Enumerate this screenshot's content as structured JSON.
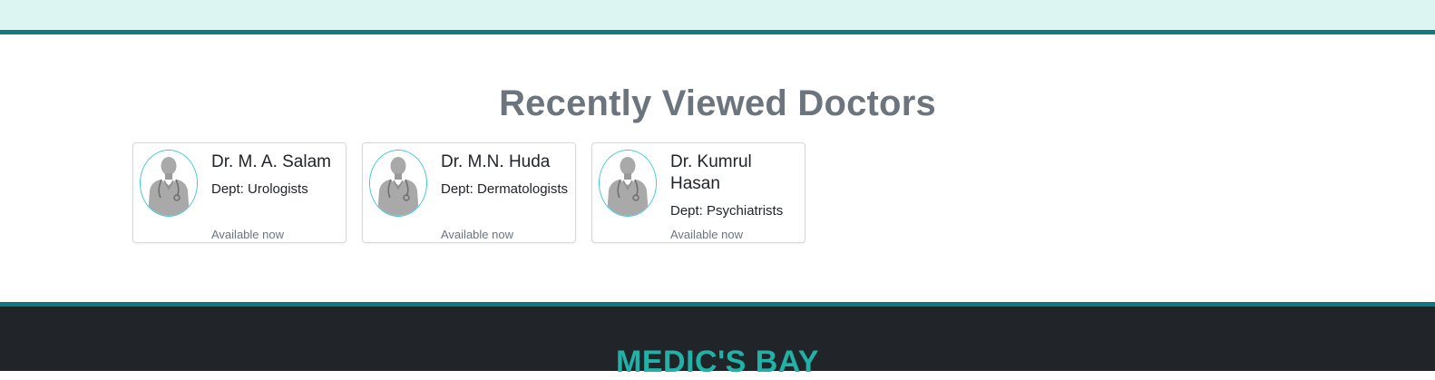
{
  "section": {
    "title": "Recently Viewed Doctors"
  },
  "doctors": [
    {
      "name": "Dr. M. A. Salam",
      "dept": "Dept: Urologists",
      "status": "Available now"
    },
    {
      "name": "Dr. M.N. Huda",
      "dept": "Dept: Dermatologists",
      "status": "Available now"
    },
    {
      "name": "Dr. Kumrul Hasan",
      "dept": "Dept: Psychiatrists",
      "status": "Available now"
    }
  ],
  "footer": {
    "brand": "MEDIC'S BAY"
  },
  "colors": {
    "accent": "#0e7a80",
    "brand": "#20b2a6",
    "top_band": "#dcf5f2",
    "footer_bg": "#212529",
    "title_gray": "#6c757d",
    "avatar_border": "#3ec6d8"
  },
  "icons": {
    "avatar": "doctor-avatar-icon"
  }
}
